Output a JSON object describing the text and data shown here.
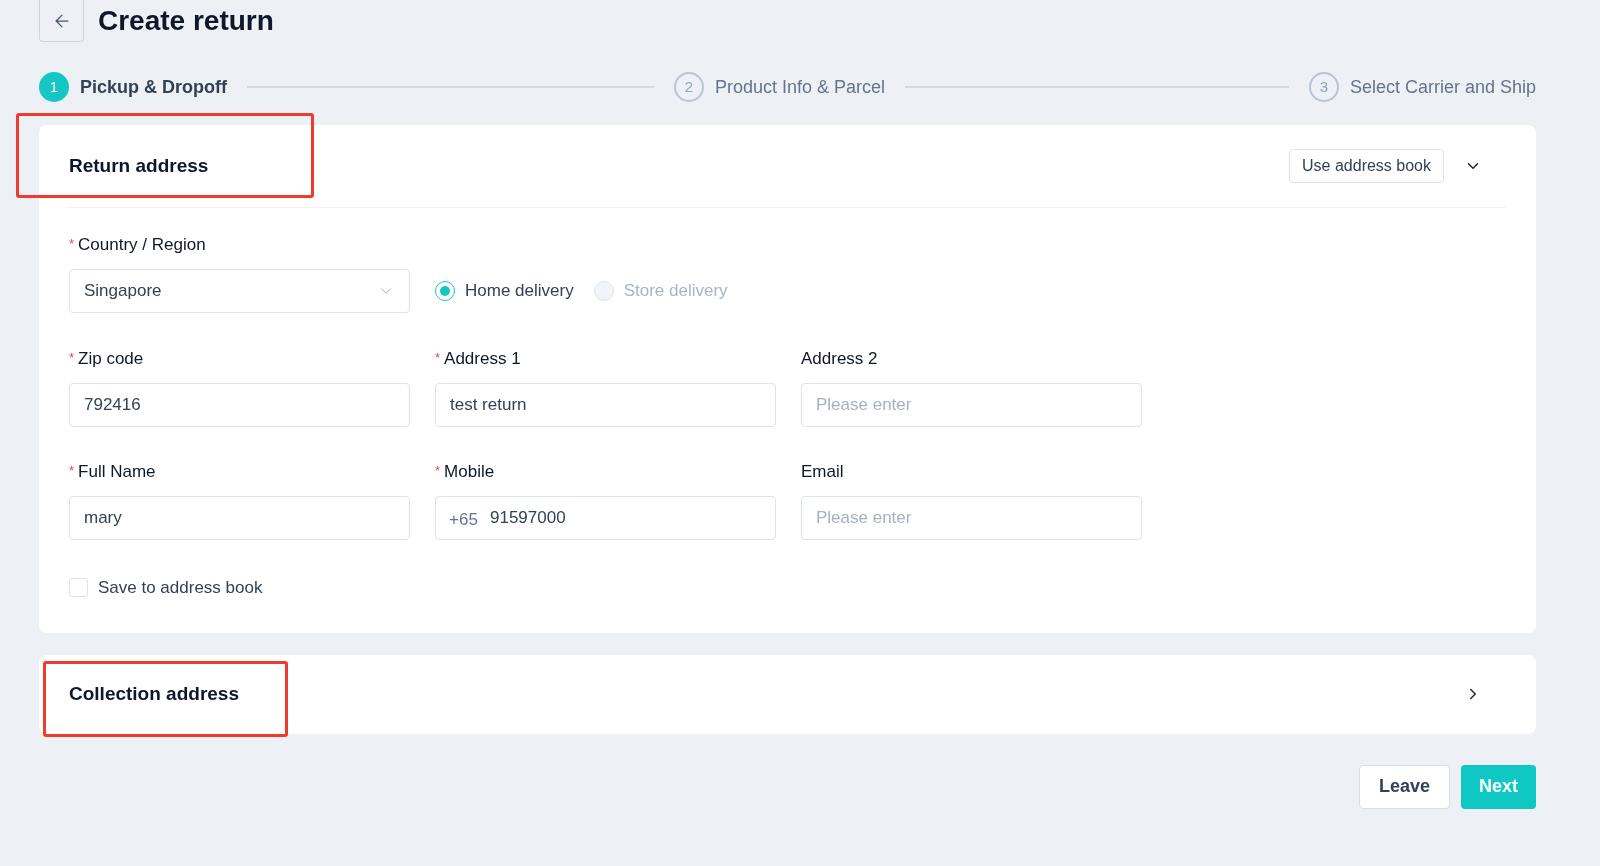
{
  "page": {
    "title": "Create return"
  },
  "steps": [
    {
      "number": "1",
      "label": "Pickup & Dropoff",
      "selected": true
    },
    {
      "number": "2",
      "label": "Product Info & Parcel",
      "selected": false
    },
    {
      "number": "3",
      "label": "Select Carrier and Ship",
      "selected": false
    }
  ],
  "return_address": {
    "title": "Return address",
    "highlighted": true,
    "address_book_button": "Use address book",
    "expanded": true,
    "country": {
      "label": "Country / Region",
      "required_mark": "*",
      "value": "Singapore"
    },
    "delivery_options": [
      {
        "label": "Home delivery",
        "selected": true,
        "disabled": false
      },
      {
        "label": "Store delivery",
        "selected": false,
        "disabled": true
      }
    ],
    "fields": [
      {
        "label": "Zip code",
        "required_mark": "*",
        "value": "792416"
      },
      {
        "label": "Address 1",
        "required_mark": "*",
        "value": "test return"
      },
      {
        "label": "Address 2",
        "placeholder": "Please enter"
      },
      {
        "label": "Full Name",
        "required_mark": "*",
        "value": "mary"
      },
      {
        "label": "Mobile",
        "required_mark": "*",
        "prefix": "+65",
        "value": "91597000"
      },
      {
        "label": "Email",
        "placeholder": "Please enter"
      }
    ],
    "save_to_book": {
      "label": "Save to address book",
      "checked": false
    }
  },
  "collection_address": {
    "title": "Collection address",
    "highlighted": true,
    "expanded": false
  },
  "buttons": {
    "leave": "Leave",
    "next": "Next"
  }
}
